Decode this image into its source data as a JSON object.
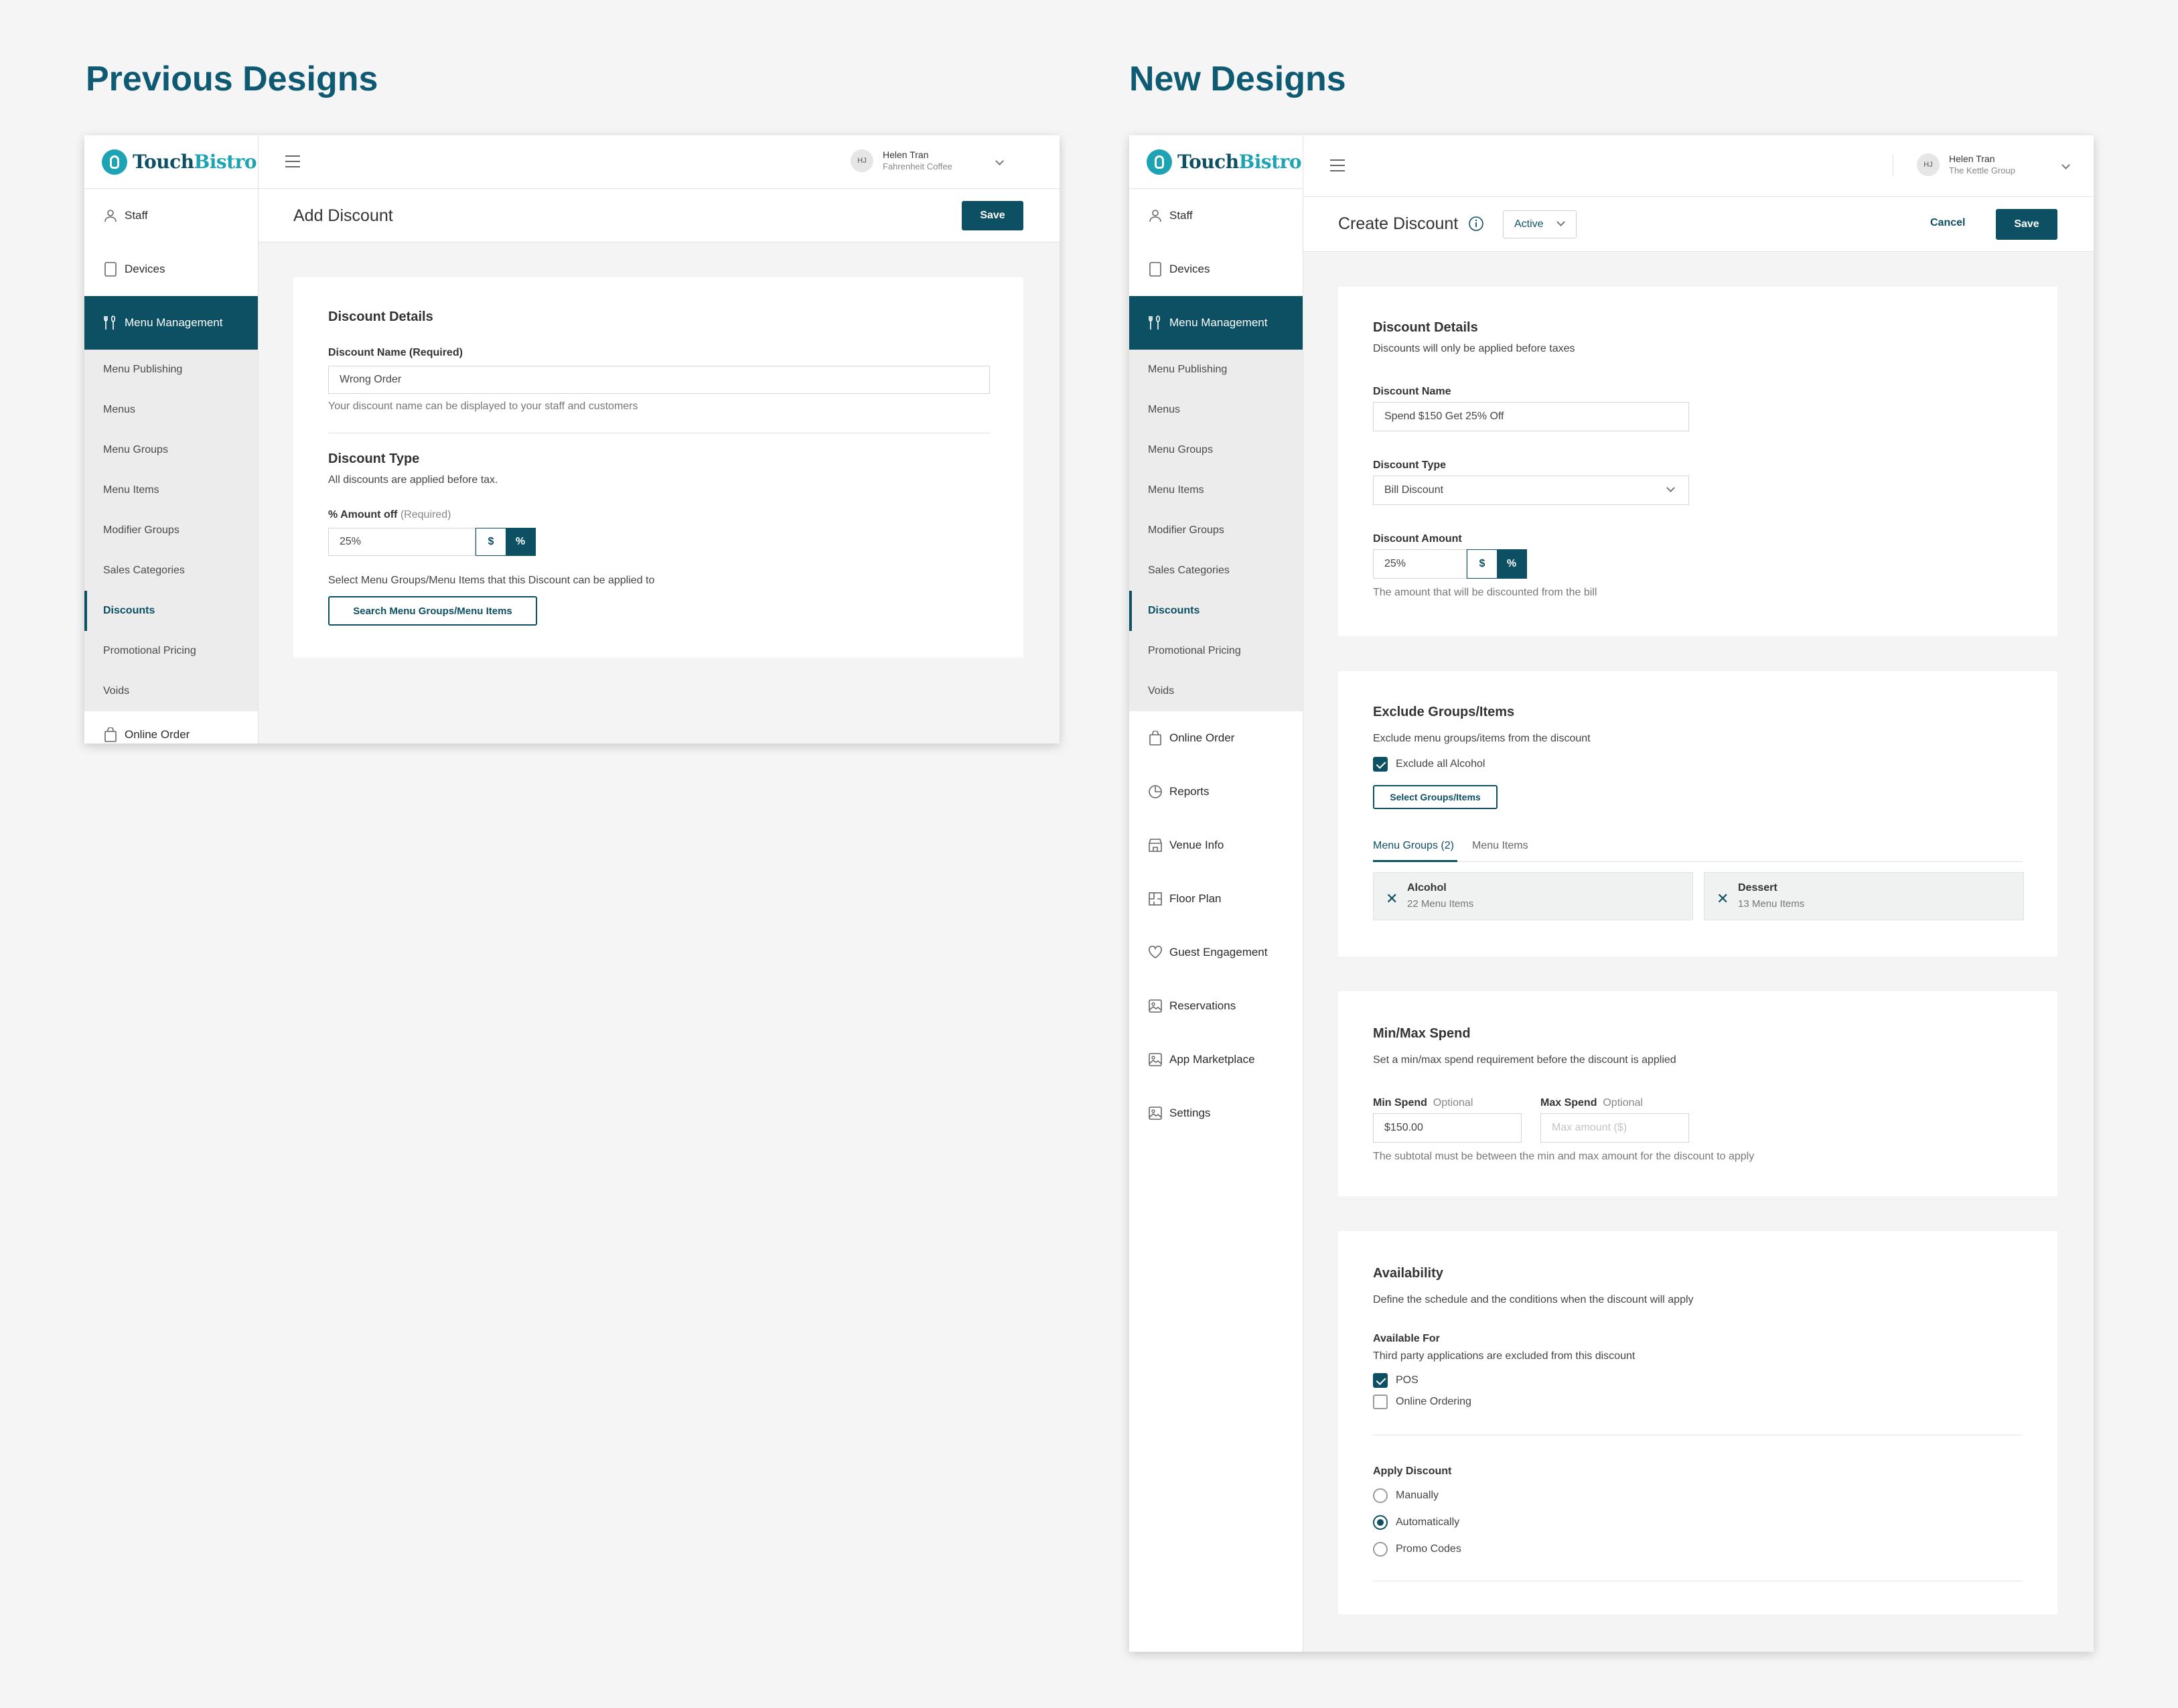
{
  "headings": {
    "previous": "Previous Designs",
    "new": "New Designs"
  },
  "brand": {
    "touch": "Touch",
    "bistro": "Bistro"
  },
  "previous": {
    "user": {
      "initials": "HJ",
      "name": "Helen Tran",
      "org": "Fahrenheit Coffee"
    },
    "nav": {
      "staff": "Staff",
      "devices": "Devices",
      "menu_management": "Menu Management",
      "online_order": "Online Order"
    },
    "submenu": [
      "Menu Publishing",
      "Menus",
      "Menu Groups",
      "Menu Items",
      "Modifier Groups",
      "Sales Categories",
      "Discounts",
      "Promotional Pricing",
      "Voids"
    ],
    "page_title": "Add Discount",
    "save": "Save",
    "details_title": "Discount Details",
    "name_label": "Discount Name (Required)",
    "name_value": "Wrong Order",
    "name_hint": "Your discount name can be displayed to your staff and customers",
    "type_title": "Discount Type",
    "type_desc": "All discounts are applied before tax.",
    "amount_label": "% Amount off",
    "amount_req": "(Required)",
    "amount_value": "25%",
    "seg_dollar": "$",
    "seg_percent": "%",
    "select_text": "Select Menu Groups/Menu Items that this Discount can be applied to",
    "search_button": "Search Menu Groups/Menu Items"
  },
  "new": {
    "user": {
      "initials": "HJ",
      "name": "Helen Tran",
      "org": "The Kettle Group"
    },
    "nav": {
      "staff": "Staff",
      "devices": "Devices",
      "menu_management": "Menu Management"
    },
    "submenu": [
      "Menu Publishing",
      "Menus",
      "Menu Groups",
      "Menu Items",
      "Modifier Groups",
      "Sales Categories",
      "Discounts",
      "Promotional Pricing",
      "Voids"
    ],
    "nav_lower": [
      "Online Order",
      "Reports",
      "Venue Info",
      "Floor Plan",
      "Guest Engagement",
      "Reservations",
      "App Marketplace",
      "Settings"
    ],
    "page_title": "Create Discount",
    "status": "Active",
    "cancel": "Cancel",
    "save": "Save",
    "details": {
      "title": "Discount Details",
      "desc": "Discounts will only be applied before taxes",
      "name_label": "Discount Name",
      "name_value": "Spend $150 Get 25% Off",
      "type_label": "Discount Type",
      "type_value": "Bill Discount",
      "amount_label": "Discount Amount",
      "amount_value": "25%",
      "seg_dollar": "$",
      "seg_percent": "%",
      "amount_hint": "The amount that will be discounted from the bill"
    },
    "exclude": {
      "title": "Exclude Groups/Items",
      "desc": "Exclude menu groups/items from the discount",
      "alcohol": "Exclude all Alcohol",
      "select_button": "Select Groups/Items",
      "tab_groups": "Menu Groups (2)",
      "tab_items": "Menu Items",
      "chips": [
        {
          "name": "Alcohol",
          "count": "22 Menu Items"
        },
        {
          "name": "Dessert",
          "count": "13 Menu Items"
        }
      ]
    },
    "spend": {
      "title": "Min/Max Spend",
      "desc": "Set a min/max spend requirement before the discount is applied",
      "min_label": "Min Spend",
      "max_label": "Max Spend",
      "optional": "Optional",
      "min_value": "$150.00",
      "max_placeholder": "Max amount ($)",
      "hint": "The subtotal must be between the min and max amount for the discount to apply"
    },
    "availability": {
      "title": "Availability",
      "desc": "Define the schedule and the conditions when the discount will apply",
      "for_label": "Available For",
      "for_desc": "Third party applications are excluded from this discount",
      "pos": "POS",
      "online": "Online Ordering",
      "apply_label": "Apply Discount",
      "manually": "Manually",
      "automatically": "Automatically",
      "promo": "Promo Codes"
    }
  }
}
